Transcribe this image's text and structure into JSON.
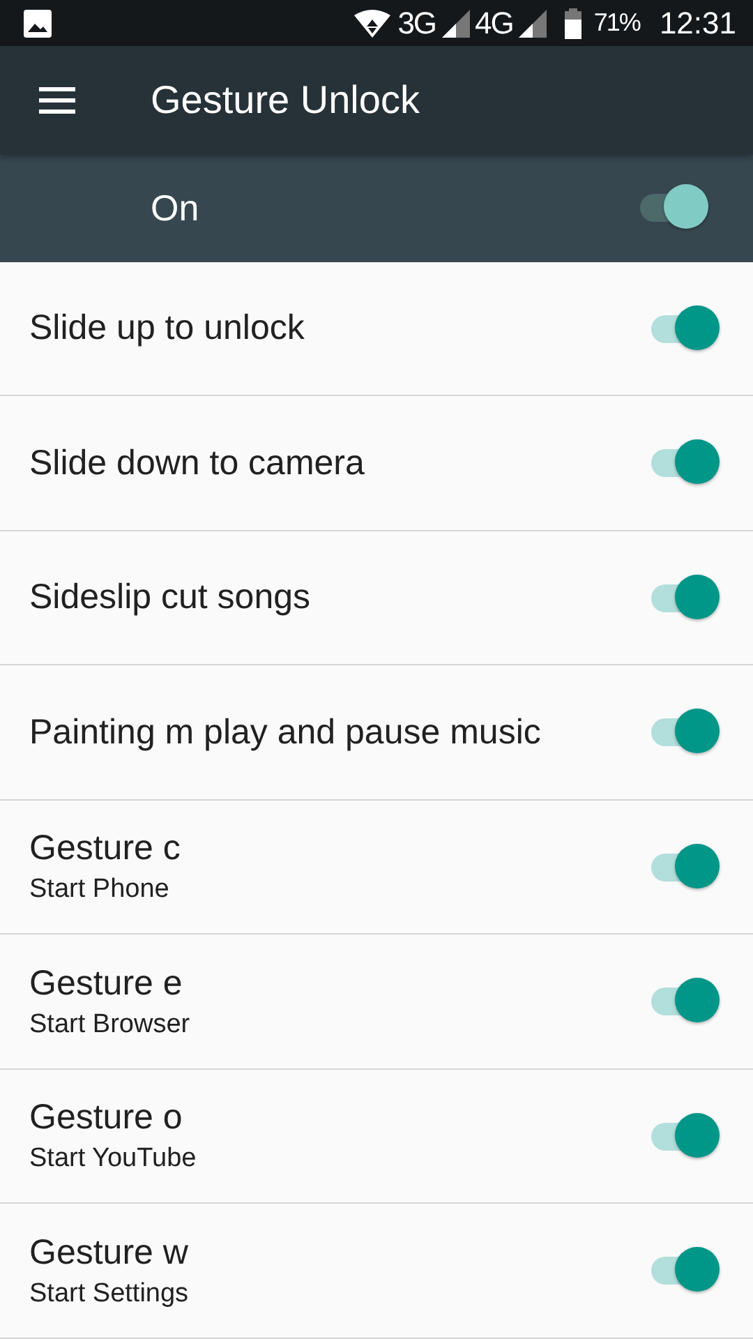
{
  "status_bar": {
    "network_3g": "3G",
    "network_4g": "4G",
    "battery": "71%",
    "time": "12:31"
  },
  "toolbar": {
    "title": "Gesture Unlock"
  },
  "master_switch": {
    "label": "On",
    "on": true
  },
  "settings": [
    {
      "title": "Slide up to unlock",
      "on": true
    },
    {
      "title": "Slide down to camera",
      "on": true
    },
    {
      "title": "Sideslip cut songs",
      "on": true
    },
    {
      "title": "Painting m play and pause music",
      "on": true
    },
    {
      "title": "Gesture c",
      "subtitle": "Start Phone",
      "on": true
    },
    {
      "title": "Gesture e",
      "subtitle": "Start Browser",
      "on": true
    },
    {
      "title": "Gesture o",
      "subtitle": "Start YouTube",
      "on": true
    },
    {
      "title": "Gesture w",
      "subtitle": "Start Settings",
      "on": true
    }
  ]
}
